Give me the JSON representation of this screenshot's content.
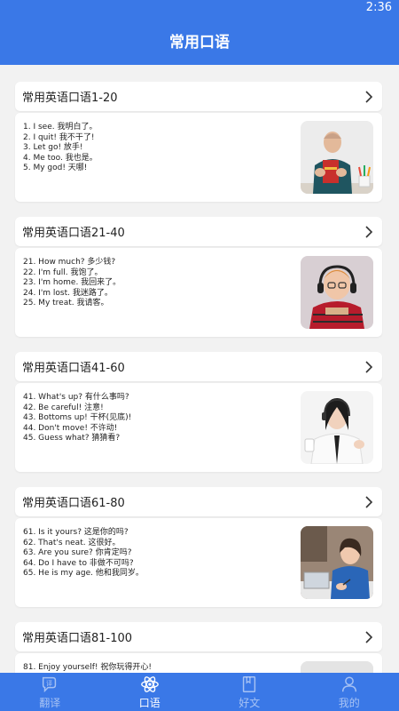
{
  "status": {
    "time": "2:36"
  },
  "header": {
    "title": "常用口语"
  },
  "cards": [
    {
      "title": "常用英语口语1-20",
      "lines": [
        "1. I see. 我明白了。",
        "2. I quit! 我不干了!",
        "3. Let go! 放手!",
        "4. Me too. 我也是。",
        "5. My god! 天哪!"
      ],
      "image": "man-holding-book"
    },
    {
      "title": "常用英语口语21-40",
      "lines": [
        "21. How much? 多少钱?",
        "22. I'm full. 我饱了。",
        "23. I'm home. 我回来了。",
        "24. I'm lost. 我迷路了。",
        "25. My treat. 我请客。"
      ],
      "image": "boy-with-headphones"
    },
    {
      "title": "常用英语口语41-60",
      "lines": [
        "41. What's up? 有什么事吗?",
        "42. Be careful! 注意!",
        "43. Bottoms up! 干杯(见底)!",
        "44. Don't move! 不许动!",
        "45. Guess what? 猜猜看?"
      ],
      "image": "woman-with-headset"
    },
    {
      "title": "常用英语口语61-80",
      "lines": [
        "61. Is it yours? 这是你的吗?",
        "62. That's neat. 这很好。",
        "63. Are you sure? 你肯定吗?",
        "64. Do I have to 非做不可吗?",
        "65. He is my age. 他和我同岁。"
      ],
      "image": "woman-writing"
    },
    {
      "title": "常用英语口语81-100",
      "lines": [
        "81. Enjoy yourself! 祝你玩得开心!"
      ],
      "image": "partial-photo"
    }
  ],
  "tabs": [
    {
      "label": "翻译",
      "icon": "translate-icon",
      "active": false
    },
    {
      "label": "口语",
      "icon": "atom-icon",
      "active": true
    },
    {
      "label": "好文",
      "icon": "book-icon",
      "active": false
    },
    {
      "label": "我的",
      "icon": "person-icon",
      "active": false
    }
  ],
  "colors": {
    "primary": "#3a78e7",
    "background": "#f2f2f2"
  }
}
